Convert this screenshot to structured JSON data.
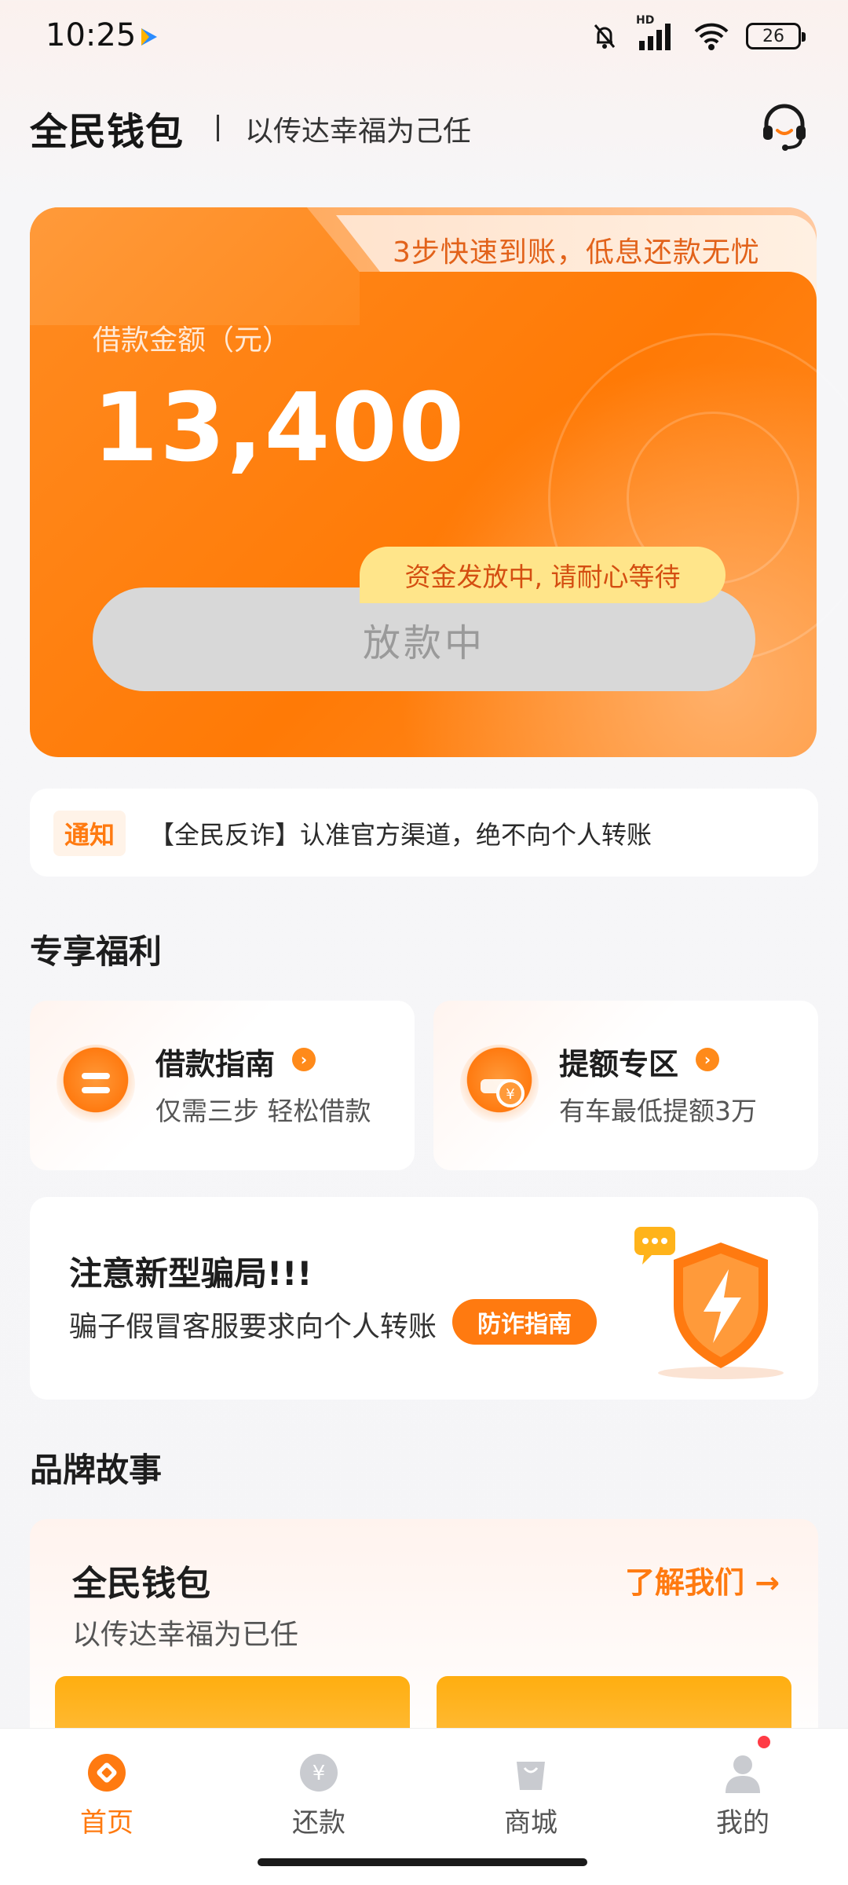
{
  "status_bar": {
    "time": "10:25",
    "network": "HD",
    "battery": "26"
  },
  "header": {
    "brand": "全民钱包",
    "slogan": "以传达幸福为己任"
  },
  "loan_card": {
    "tab_text": "3步快速到账，低息还款无忧",
    "amount_label": "借款金额（元）",
    "amount": "13,400",
    "status_tip": "资金发放中, 请耐心等待",
    "status_button": "放款中"
  },
  "notice": {
    "tag": "通知",
    "text": "【全民反诈】认准官方渠道，绝不向个人转账"
  },
  "benefits": {
    "section_title": "专享福利",
    "items": [
      {
        "title": "借款指南",
        "subtitle": "仅需三步 轻松借款"
      },
      {
        "title": "提额专区",
        "subtitle": "有车最低提额3万"
      }
    ]
  },
  "fraud_card": {
    "title": "注意新型骗局!!!",
    "desc": "骗子假冒客服要求向个人转账",
    "button": "防诈指南"
  },
  "brand_story": {
    "section_title": "品牌故事",
    "title": "全民钱包",
    "subtitle": "以传达幸福为已任",
    "link": "了解我们 →"
  },
  "bottom_nav": {
    "items": [
      {
        "label": "首页"
      },
      {
        "label": "还款"
      },
      {
        "label": "商城"
      },
      {
        "label": "我的"
      }
    ]
  },
  "colors": {
    "accent": "#ff7a10",
    "card": "#ff8a1f",
    "tip_bg": "#ffe58a"
  }
}
